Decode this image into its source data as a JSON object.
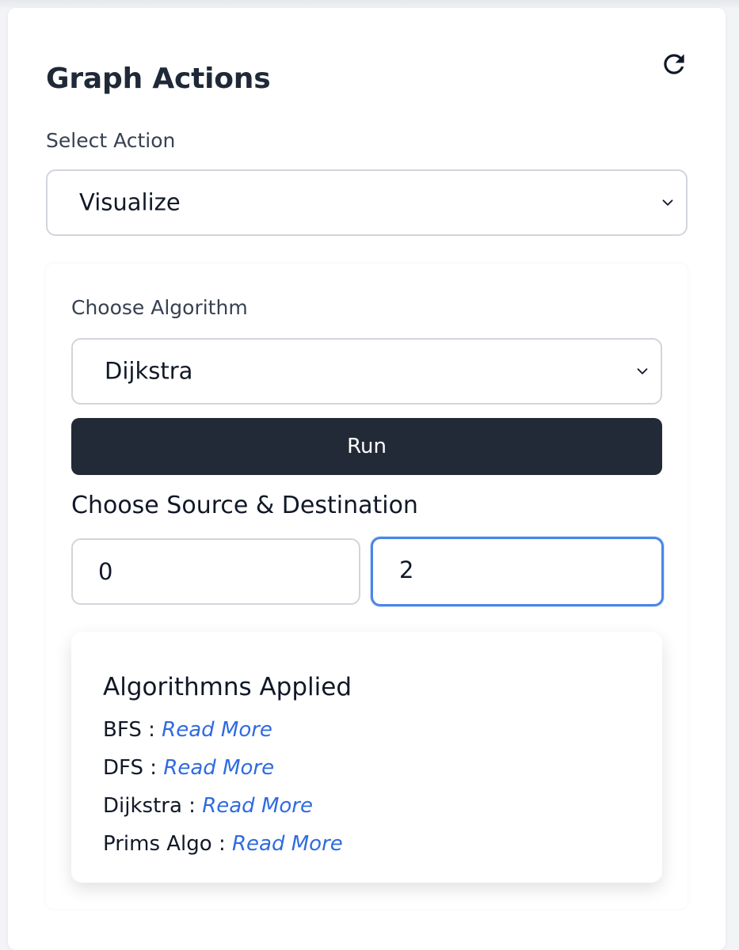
{
  "panel": {
    "title": "Graph Actions",
    "refresh_icon": "refresh-icon"
  },
  "action": {
    "label": "Select Action",
    "selected": "Visualize"
  },
  "algorithm": {
    "label": "Choose Algorithm",
    "selected": "Dijkstra",
    "run_label": "Run"
  },
  "route": {
    "heading": "Choose Source & Destination",
    "source_value": "0",
    "destination_value": "2"
  },
  "applied": {
    "title": "Algorithmns Applied",
    "items": [
      {
        "name": "BFS :",
        "link": "Read More"
      },
      {
        "name": "DFS :",
        "link": "Read More"
      },
      {
        "name": "Dijkstra :",
        "link": "Read More"
      },
      {
        "name": "Prims Algo :",
        "link": "Read More"
      }
    ]
  },
  "colors": {
    "primary_button": "#222a37",
    "link": "#2f6be0",
    "focus_ring": "#4a86e8"
  }
}
